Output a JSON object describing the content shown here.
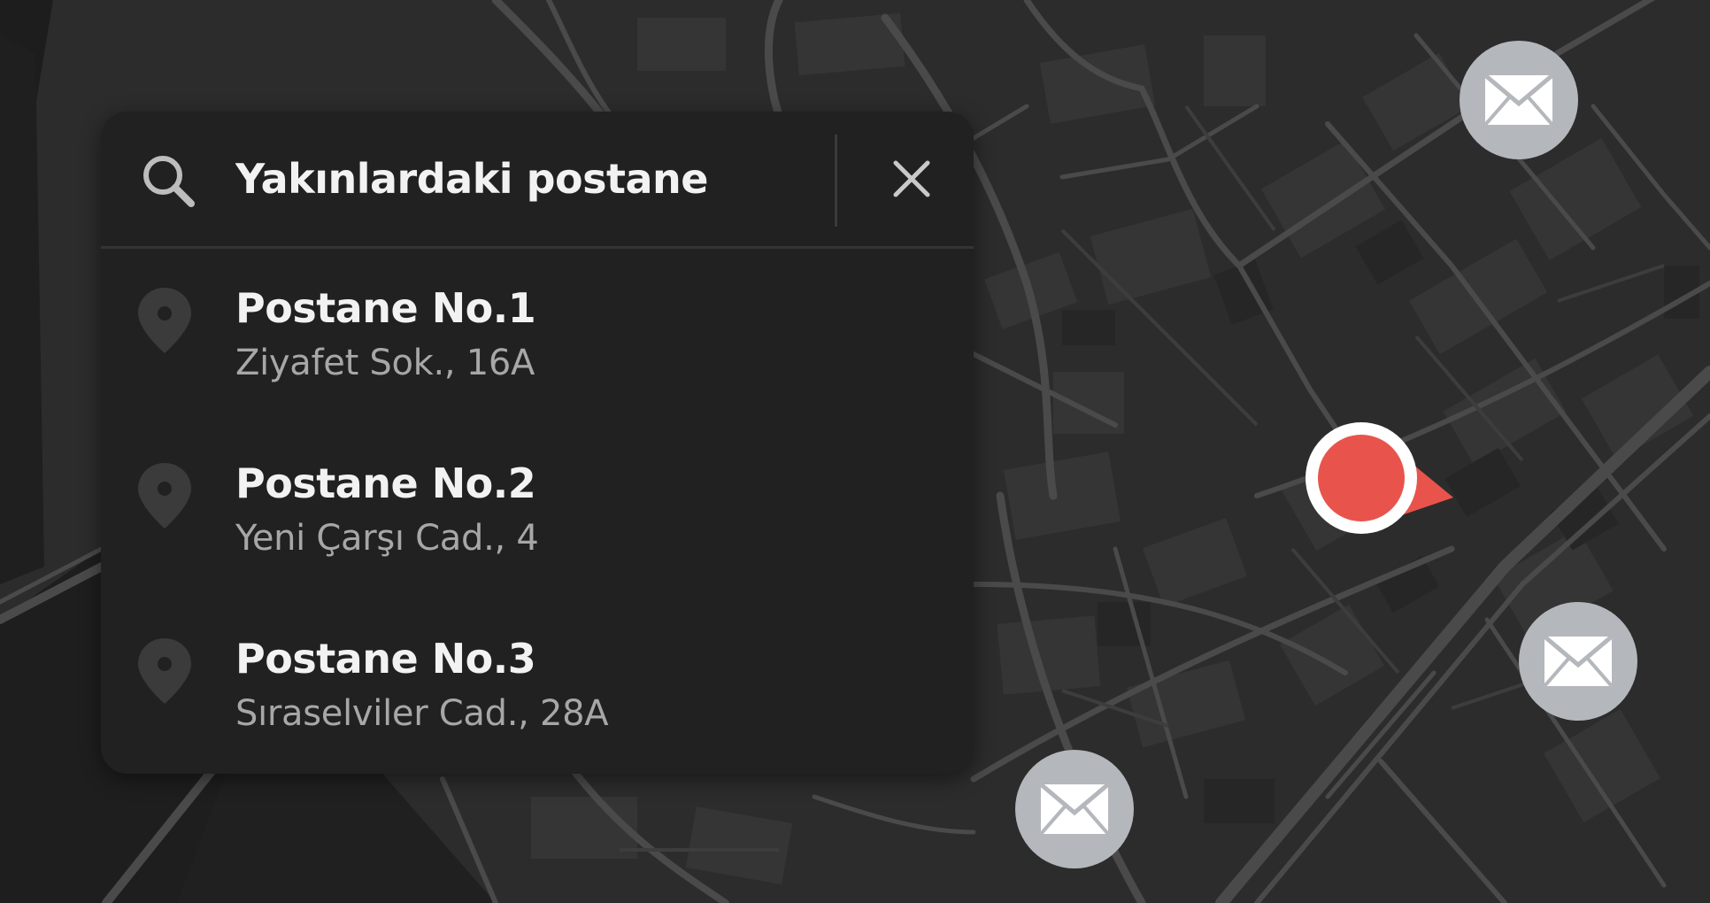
{
  "search": {
    "query": "Yakınlardaki postane",
    "icon": "search-icon",
    "clear_icon": "close-icon"
  },
  "results": [
    {
      "title": "Postane No.1",
      "address": "Ziyafet Sok., 16A",
      "icon": "pin-icon"
    },
    {
      "title": "Postane No.2",
      "address": "Yeni Çarşı Cad., 4",
      "icon": "pin-icon"
    },
    {
      "title": "Postane No.3",
      "address": "Sıraselviler Cad., 28A",
      "icon": "pin-icon"
    }
  ],
  "map": {
    "markers": [
      "mail-icon",
      "mail-icon",
      "mail-icon"
    ],
    "user_location": "current-location-marker"
  },
  "colors": {
    "background": "#2b2b2b",
    "panel": "#212121",
    "accent_red": "#e8544c",
    "marker_gray": "#b4b7bc"
  }
}
